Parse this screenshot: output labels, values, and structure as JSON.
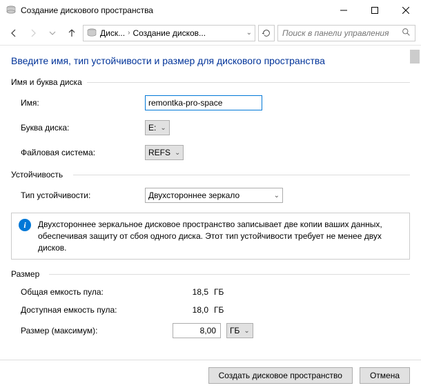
{
  "window": {
    "title": "Создание дискового пространства"
  },
  "breadcrumb": {
    "seg1": "Диск...",
    "seg2": "Создание дисков..."
  },
  "search": {
    "placeholder": "Поиск в панели управления"
  },
  "page": {
    "title": "Введите имя, тип устойчивости и размер для дискового пространства"
  },
  "groups": {
    "name_drive": "Имя и буква диска",
    "resiliency": "Устойчивость",
    "size": "Размер"
  },
  "form": {
    "name_label": "Имя:",
    "name_value": "remontka-pro-space",
    "drive_label": "Буква диска:",
    "drive_value": "E:",
    "fs_label": "Файловая система:",
    "fs_value": "REFS",
    "resiliency_label": "Тип устойчивости:",
    "resiliency_value": "Двухстороннее зеркало"
  },
  "info": {
    "text": "Двухстороннее зеркальное дисковое пространство записывает две копии ваших данных, обеспечивая защиту от сбоя одного диска. Этот тип устойчивости требует не менее двух дисков."
  },
  "size": {
    "total_label": "Общая емкость пула:",
    "total_value": "18,5",
    "total_unit": "ГБ",
    "avail_label": "Доступная емкость пула:",
    "avail_value": "18,0",
    "avail_unit": "ГБ",
    "max_label": "Размер (максимум):",
    "max_value": "8,00",
    "max_unit": "ГБ"
  },
  "buttons": {
    "create": "Создать дисковое пространство",
    "cancel": "Отмена"
  }
}
